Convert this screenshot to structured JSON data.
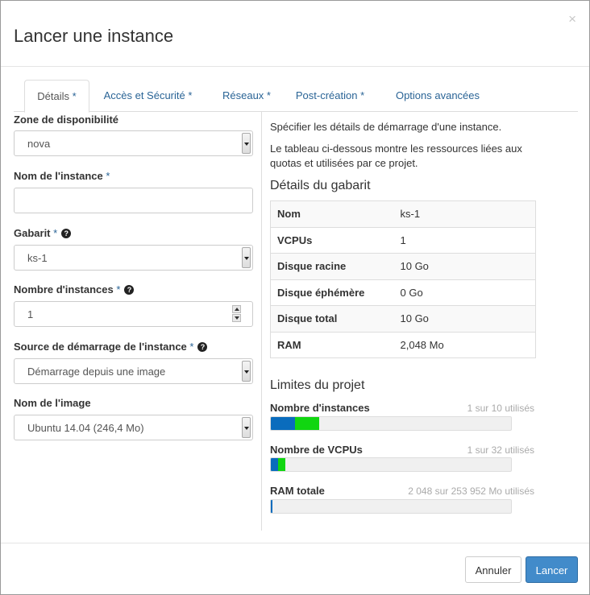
{
  "title": "Lancer une instance",
  "close_label": "×",
  "tabs": [
    {
      "label": "Détails",
      "req": " *"
    },
    {
      "label": "Accès et Sécurité",
      "req": " *"
    },
    {
      "label": "Réseaux",
      "req": " *"
    },
    {
      "label": "Post-création",
      "req": " *"
    },
    {
      "label": "Options avancées",
      "req": ""
    }
  ],
  "form": {
    "zone": {
      "label": "Zone de disponibilité",
      "value": "nova"
    },
    "instance_name": {
      "label": "Nom de l'instance",
      "req": "*",
      "value": ""
    },
    "flavor": {
      "label": "Gabarit",
      "req": "*",
      "value": "ks-1"
    },
    "count": {
      "label": "Nombre d'instances",
      "req": "*",
      "value": "1"
    },
    "boot_source": {
      "label": "Source de démarrage de l'instance",
      "req": "*",
      "value": "Démarrage depuis une image"
    },
    "image_name": {
      "label": "Nom de l'image",
      "value": "Ubuntu 14.04 (246,4 Mo)"
    }
  },
  "help_glyph": "?",
  "right": {
    "intro1": "Spécifier les détails de démarrage d'une instance.",
    "intro2": "Le tableau ci-dessous montre les ressources liées aux quotas et utilisées par ce projet.",
    "flavor_heading": "Détails du gabarit",
    "flavor_rows": [
      {
        "key": "Nom",
        "value": "ks-1"
      },
      {
        "key": "VCPUs",
        "value": "1"
      },
      {
        "key": "Disque racine",
        "value": "10 Go"
      },
      {
        "key": "Disque éphémère",
        "value": "0 Go"
      },
      {
        "key": "Disque total",
        "value": "10 Go"
      },
      {
        "key": "RAM",
        "value": "2,048 Mo"
      }
    ],
    "limits_heading": "Limites du projet",
    "limits": [
      {
        "label": "Nombre d'instances",
        "count": "1 sur 10 utilisés",
        "used": 0.1,
        "added": 0.1
      },
      {
        "label": "Nombre de VCPUs",
        "count": "1 sur 32 utilisés",
        "used": 0.031,
        "added": 0.031
      },
      {
        "label": "RAM totale",
        "count": "2 048 sur 253 952 Mo utilisés",
        "used": 0.008,
        "added": 0.0
      }
    ]
  },
  "colors": {
    "used": "#0a6cbd",
    "added": "#11d611",
    "primary": "#428bca",
    "link": "#2a6496"
  },
  "footer": {
    "cancel": "Annuler",
    "launch": "Lancer"
  }
}
